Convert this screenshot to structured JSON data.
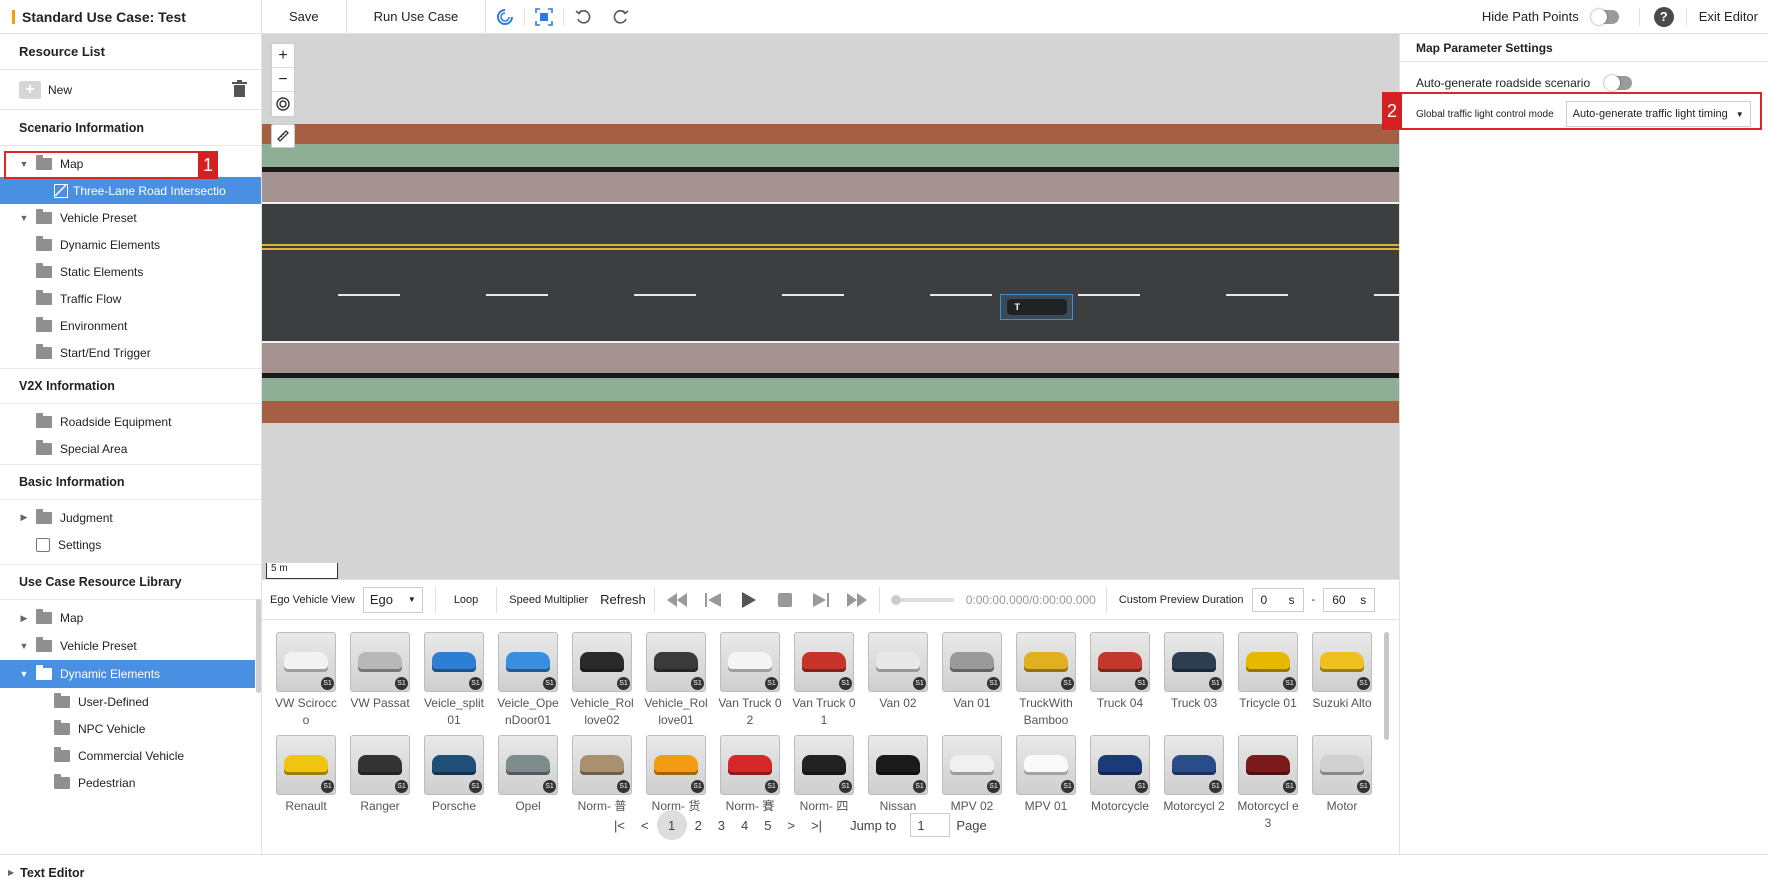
{
  "topbar": {
    "title": "Standard Use Case: Test",
    "save_label": "Save",
    "run_label": "Run Use Case",
    "hide_path_points_label": "Hide Path Points",
    "exit_label": "Exit Editor"
  },
  "sidebar": {
    "header": "Resource List",
    "new_label": "New",
    "scenario_info": "Scenario Information",
    "scenario_items": {
      "map": "Map",
      "map_child": "Three-Lane Road Intersectio",
      "vehicle_preset": "Vehicle Preset",
      "dynamic_elements": "Dynamic Elements",
      "static_elements": "Static Elements",
      "traffic_flow": "Traffic Flow",
      "environment": "Environment",
      "start_end_trigger": "Start/End Trigger"
    },
    "v2x_info": "V2X Information",
    "v2x_items": {
      "roadside": "Roadside Equipment",
      "special_area": "Special Area"
    },
    "basic_info": "Basic Information",
    "basic_items": {
      "judgment": "Judgment",
      "settings": "Settings"
    },
    "library": "Use Case Resource Library",
    "library_items": {
      "map": "Map",
      "vehicle_preset": "Vehicle Preset",
      "dynamic_elements": "Dynamic Elements",
      "user_defined": "User-Defined",
      "npc_vehicle": "NPC Vehicle",
      "commercial_vehicle": "Commercial Vehicle",
      "pedestrian": "Pedestrian"
    },
    "annotation_1": "1"
  },
  "map": {
    "scale_label": "5 m",
    "zoom_in": "+",
    "zoom_out": "−",
    "vehicle_label": "T"
  },
  "controls": {
    "ego_view_label": "Ego Vehicle View",
    "ego_value": "Ego",
    "loop_label": "Loop",
    "speed_label": "Speed Multiplier",
    "refresh_label": "Refresh",
    "time_readout": "0:00:00.000/0:00:00.000",
    "custom_duration_label": "Custom Preview Duration",
    "start_value": "0",
    "end_value": "60",
    "unit": "s",
    "dash": "-"
  },
  "library": {
    "badge": "S1",
    "items": [
      {
        "label": "VW Scirocco",
        "color": "#f2f2f2"
      },
      {
        "label": "VW Passat",
        "color": "#b8b8b8"
      },
      {
        "label": "Veicle_split01",
        "color": "#2d7fd3"
      },
      {
        "label": "Veicle_OpenDoor01",
        "color": "#3a8ee0"
      },
      {
        "label": "Vehicle_Rollove02",
        "color": "#2a2a2a"
      },
      {
        "label": "Vehicle_Rollove01",
        "color": "#3a3a3a"
      },
      {
        "label": "Van Truck 02",
        "color": "#f5f5f5"
      },
      {
        "label": "Van Truck 01",
        "color": "#c8332a"
      },
      {
        "label": "Van 02",
        "color": "#e8e8e8"
      },
      {
        "label": "Van 01",
        "color": "#9a9a9a"
      },
      {
        "label": "TruckWith Bamboo",
        "color": "#e0b020"
      },
      {
        "label": "Truck 04",
        "color": "#c0392b"
      },
      {
        "label": "Truck 03",
        "color": "#2c3e50"
      },
      {
        "label": "Tricycle 01",
        "color": "#e6b800"
      },
      {
        "label": "Suzuki Alto",
        "color": "#f0c020"
      },
      {
        "label": "Renault",
        "color": "#f1c40f"
      },
      {
        "label": "Ranger",
        "color": "#333333"
      },
      {
        "label": "Porsche",
        "color": "#1f4e79"
      },
      {
        "label": "Opel",
        "color": "#7f8c8d"
      },
      {
        "label": "Norm- 普",
        "color": "#a89070"
      },
      {
        "label": "Norm- 货",
        "color": "#f39c12"
      },
      {
        "label": "Norm- 賽",
        "color": "#d62828"
      },
      {
        "label": "Norm- 四",
        "color": "#222222"
      },
      {
        "label": "Nissan",
        "color": "#1a1a1a"
      },
      {
        "label": "MPV 02",
        "color": "#f0f0f0"
      },
      {
        "label": "MPV 01",
        "color": "#fafafa"
      },
      {
        "label": "Motorcycle",
        "color": "#1a3a7a"
      },
      {
        "label": "Motorcycl 2",
        "color": "#2a4d8a"
      },
      {
        "label": "Motorcycl e 3",
        "color": "#7a1a1a"
      },
      {
        "label": "Motor",
        "color": "#d0d0d0"
      }
    ]
  },
  "pager": {
    "pages": [
      "1",
      "2",
      "3",
      "4",
      "5"
    ],
    "jump_label": "Jump to",
    "jump_value": "1",
    "page_label": "Page"
  },
  "rpanel": {
    "header": "Map Parameter Settings",
    "auto_roadside_label": "Auto-generate roadside scenario",
    "traffic_mode_label": "Global traffic light control mode",
    "traffic_mode_value": "Auto-generate traffic light timing",
    "annotation_2": "2"
  },
  "footer": {
    "text_editor": "Text Editor"
  },
  "colors": {
    "selection": "#4a90e2",
    "annotation_red": "#d32020",
    "title_accent": "#f2a20a"
  }
}
